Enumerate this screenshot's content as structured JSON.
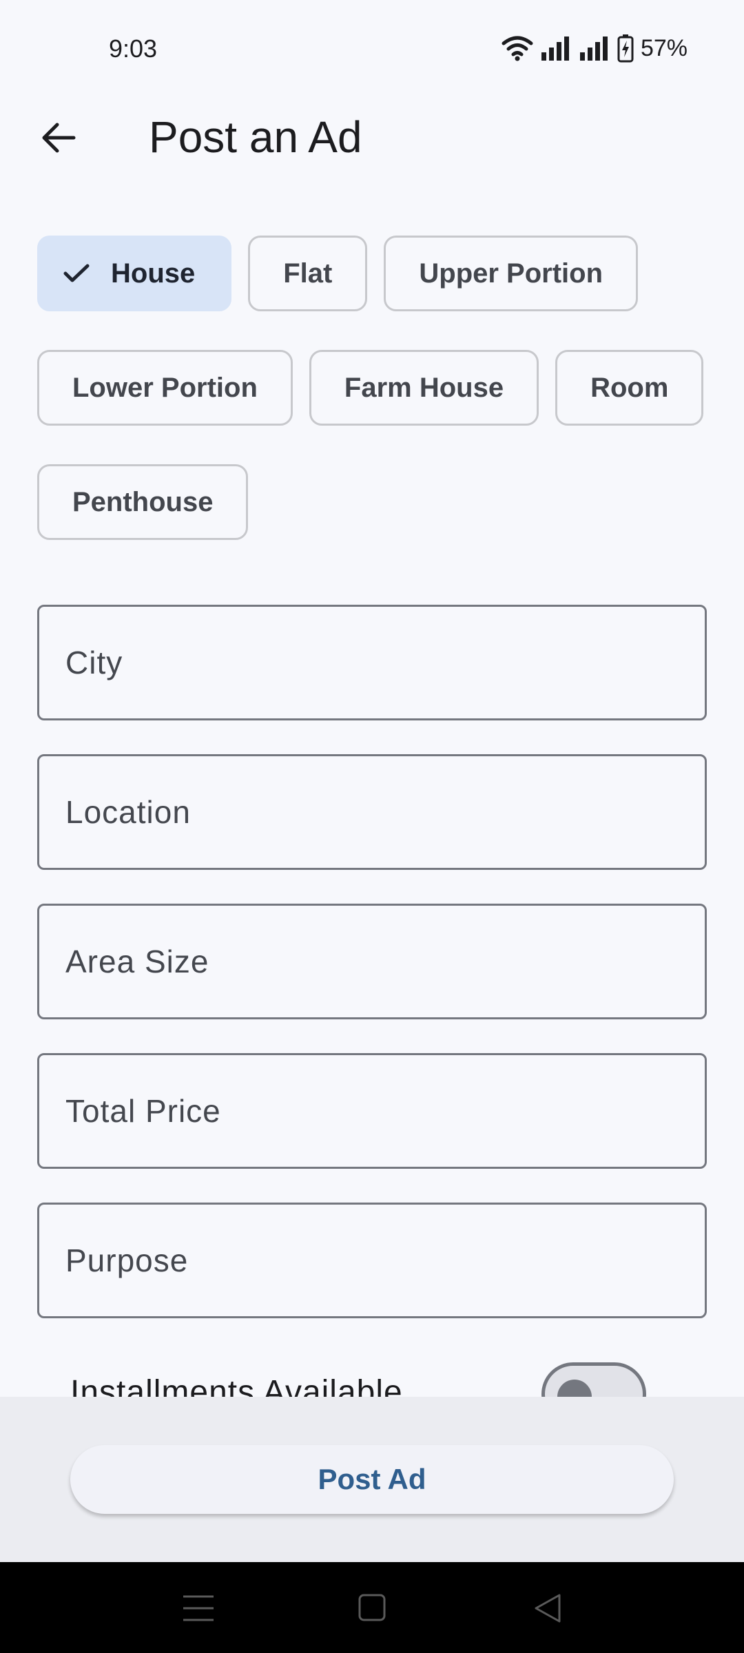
{
  "status_bar": {
    "time": "9:03",
    "battery": "57%",
    "icons": [
      "wifi-icon",
      "signal-icon",
      "signal-icon",
      "battery-charging-icon"
    ]
  },
  "app_bar": {
    "back_icon": "arrow-left-icon",
    "title": "Post an Ad"
  },
  "property_types": [
    {
      "label": "House",
      "selected": true
    },
    {
      "label": "Flat",
      "selected": false
    },
    {
      "label": "Upper Portion",
      "selected": false
    },
    {
      "label": "Lower Portion",
      "selected": false
    },
    {
      "label": "Farm House",
      "selected": false
    },
    {
      "label": "Room",
      "selected": false
    },
    {
      "label": "Penthouse",
      "selected": false
    }
  ],
  "fields": [
    {
      "placeholder": "City",
      "value": ""
    },
    {
      "placeholder": "Location",
      "value": ""
    },
    {
      "placeholder": "Area Size",
      "value": ""
    },
    {
      "placeholder": "Total Price",
      "value": ""
    },
    {
      "placeholder": "Purpose",
      "value": ""
    }
  ],
  "installments": {
    "label": "Installments Available",
    "enabled": false
  },
  "actions": {
    "post_label": "Post Ad"
  },
  "colors": {
    "background": "#f7f8fc",
    "chip_selected": "#d8e4f7",
    "primary_text": "#2f5e8e",
    "outline": "#74777f"
  },
  "nav": {
    "icons": [
      "menu-icon",
      "home-square-icon",
      "back-triangle-icon"
    ]
  }
}
